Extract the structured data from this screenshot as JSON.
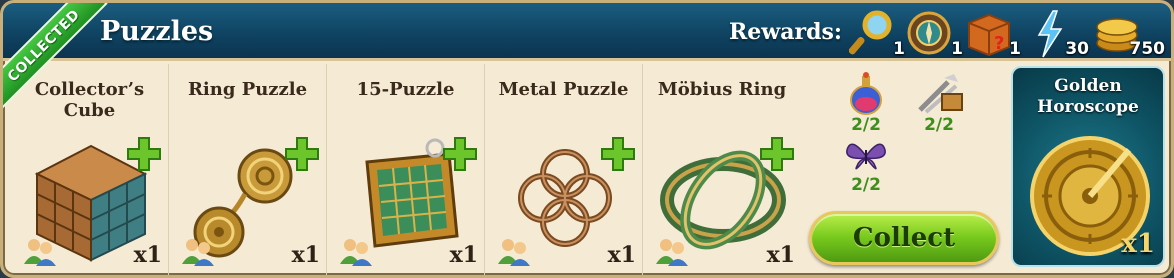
{
  "header": {
    "title": "Puzzles",
    "rewards_label": "Rewards:"
  },
  "ribbon": {
    "label": "COLLECTED"
  },
  "rewards": [
    {
      "icon": "magnifier-icon",
      "count": "1"
    },
    {
      "icon": "compass-icon",
      "count": "1"
    },
    {
      "icon": "mystery-box-icon",
      "count": "1"
    },
    {
      "icon": "lightning-icon",
      "count": "30"
    },
    {
      "icon": "coins-icon",
      "count": "750"
    }
  ],
  "items": [
    {
      "name": "Collector’s Cube",
      "qty": "x1",
      "icon": "collectors-cube-icon"
    },
    {
      "name": "Ring Puzzle",
      "qty": "x1",
      "icon": "ring-puzzle-icon"
    },
    {
      "name": "15-Puzzle",
      "qty": "x1",
      "icon": "fifteen-puzzle-icon"
    },
    {
      "name": "Metal Puzzle",
      "qty": "x1",
      "icon": "metal-puzzle-icon"
    },
    {
      "name": "Möbius Ring",
      "qty": "x1",
      "icon": "mobius-ring-icon"
    }
  ],
  "materials": [
    {
      "icon": "potion-icon",
      "count": "2/2"
    },
    {
      "icon": "tools-icon",
      "count": "2/2"
    },
    {
      "icon": "butterfly-icon",
      "count": "2/2"
    }
  ],
  "collect_button": {
    "label": "Collect"
  },
  "result": {
    "name": "Golden Horoscope",
    "qty": "x1",
    "icon": "golden-horoscope-icon"
  },
  "colors": {
    "header": "#0f4462",
    "accent_green": "#3c8f1b",
    "panel": "#f5ead4",
    "result_bg": "#0e5566"
  }
}
